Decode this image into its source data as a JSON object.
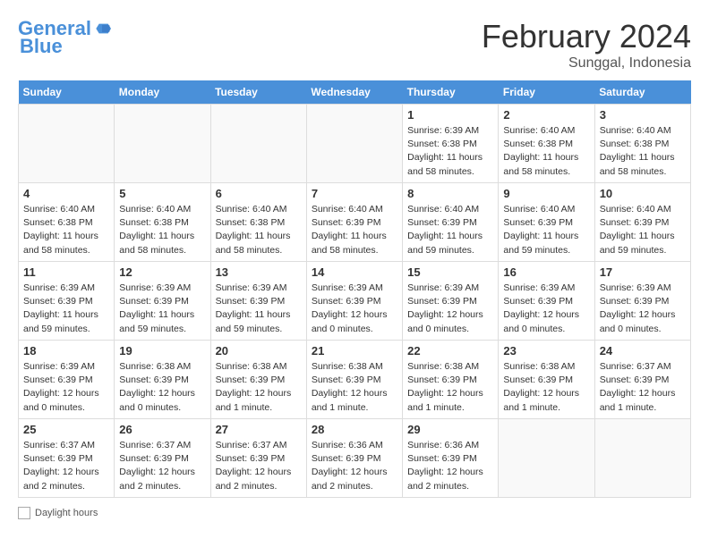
{
  "header": {
    "logo_line1": "General",
    "logo_line2": "Blue",
    "month_title": "February 2024",
    "location": "Sunggal, Indonesia"
  },
  "days_of_week": [
    "Sunday",
    "Monday",
    "Tuesday",
    "Wednesday",
    "Thursday",
    "Friday",
    "Saturday"
  ],
  "weeks": [
    [
      {
        "day": "",
        "info": ""
      },
      {
        "day": "",
        "info": ""
      },
      {
        "day": "",
        "info": ""
      },
      {
        "day": "",
        "info": ""
      },
      {
        "day": "1",
        "info": "Sunrise: 6:39 AM\nSunset: 6:38 PM\nDaylight: 11 hours\nand 58 minutes."
      },
      {
        "day": "2",
        "info": "Sunrise: 6:40 AM\nSunset: 6:38 PM\nDaylight: 11 hours\nand 58 minutes."
      },
      {
        "day": "3",
        "info": "Sunrise: 6:40 AM\nSunset: 6:38 PM\nDaylight: 11 hours\nand 58 minutes."
      }
    ],
    [
      {
        "day": "4",
        "info": "Sunrise: 6:40 AM\nSunset: 6:38 PM\nDaylight: 11 hours\nand 58 minutes."
      },
      {
        "day": "5",
        "info": "Sunrise: 6:40 AM\nSunset: 6:38 PM\nDaylight: 11 hours\nand 58 minutes."
      },
      {
        "day": "6",
        "info": "Sunrise: 6:40 AM\nSunset: 6:38 PM\nDaylight: 11 hours\nand 58 minutes."
      },
      {
        "day": "7",
        "info": "Sunrise: 6:40 AM\nSunset: 6:39 PM\nDaylight: 11 hours\nand 58 minutes."
      },
      {
        "day": "8",
        "info": "Sunrise: 6:40 AM\nSunset: 6:39 PM\nDaylight: 11 hours\nand 59 minutes."
      },
      {
        "day": "9",
        "info": "Sunrise: 6:40 AM\nSunset: 6:39 PM\nDaylight: 11 hours\nand 59 minutes."
      },
      {
        "day": "10",
        "info": "Sunrise: 6:40 AM\nSunset: 6:39 PM\nDaylight: 11 hours\nand 59 minutes."
      }
    ],
    [
      {
        "day": "11",
        "info": "Sunrise: 6:39 AM\nSunset: 6:39 PM\nDaylight: 11 hours\nand 59 minutes."
      },
      {
        "day": "12",
        "info": "Sunrise: 6:39 AM\nSunset: 6:39 PM\nDaylight: 11 hours\nand 59 minutes."
      },
      {
        "day": "13",
        "info": "Sunrise: 6:39 AM\nSunset: 6:39 PM\nDaylight: 11 hours\nand 59 minutes."
      },
      {
        "day": "14",
        "info": "Sunrise: 6:39 AM\nSunset: 6:39 PM\nDaylight: 12 hours\nand 0 minutes."
      },
      {
        "day": "15",
        "info": "Sunrise: 6:39 AM\nSunset: 6:39 PM\nDaylight: 12 hours\nand 0 minutes."
      },
      {
        "day": "16",
        "info": "Sunrise: 6:39 AM\nSunset: 6:39 PM\nDaylight: 12 hours\nand 0 minutes."
      },
      {
        "day": "17",
        "info": "Sunrise: 6:39 AM\nSunset: 6:39 PM\nDaylight: 12 hours\nand 0 minutes."
      }
    ],
    [
      {
        "day": "18",
        "info": "Sunrise: 6:39 AM\nSunset: 6:39 PM\nDaylight: 12 hours\nand 0 minutes."
      },
      {
        "day": "19",
        "info": "Sunrise: 6:38 AM\nSunset: 6:39 PM\nDaylight: 12 hours\nand 0 minutes."
      },
      {
        "day": "20",
        "info": "Sunrise: 6:38 AM\nSunset: 6:39 PM\nDaylight: 12 hours\nand 1 minute."
      },
      {
        "day": "21",
        "info": "Sunrise: 6:38 AM\nSunset: 6:39 PM\nDaylight: 12 hours\nand 1 minute."
      },
      {
        "day": "22",
        "info": "Sunrise: 6:38 AM\nSunset: 6:39 PM\nDaylight: 12 hours\nand 1 minute."
      },
      {
        "day": "23",
        "info": "Sunrise: 6:38 AM\nSunset: 6:39 PM\nDaylight: 12 hours\nand 1 minute."
      },
      {
        "day": "24",
        "info": "Sunrise: 6:37 AM\nSunset: 6:39 PM\nDaylight: 12 hours\nand 1 minute."
      }
    ],
    [
      {
        "day": "25",
        "info": "Sunrise: 6:37 AM\nSunset: 6:39 PM\nDaylight: 12 hours\nand 2 minutes."
      },
      {
        "day": "26",
        "info": "Sunrise: 6:37 AM\nSunset: 6:39 PM\nDaylight: 12 hours\nand 2 minutes."
      },
      {
        "day": "27",
        "info": "Sunrise: 6:37 AM\nSunset: 6:39 PM\nDaylight: 12 hours\nand 2 minutes."
      },
      {
        "day": "28",
        "info": "Sunrise: 6:36 AM\nSunset: 6:39 PM\nDaylight: 12 hours\nand 2 minutes."
      },
      {
        "day": "29",
        "info": "Sunrise: 6:36 AM\nSunset: 6:39 PM\nDaylight: 12 hours\nand 2 minutes."
      },
      {
        "day": "",
        "info": ""
      },
      {
        "day": "",
        "info": ""
      }
    ]
  ],
  "footer": {
    "daylight_label": "Daylight hours"
  }
}
